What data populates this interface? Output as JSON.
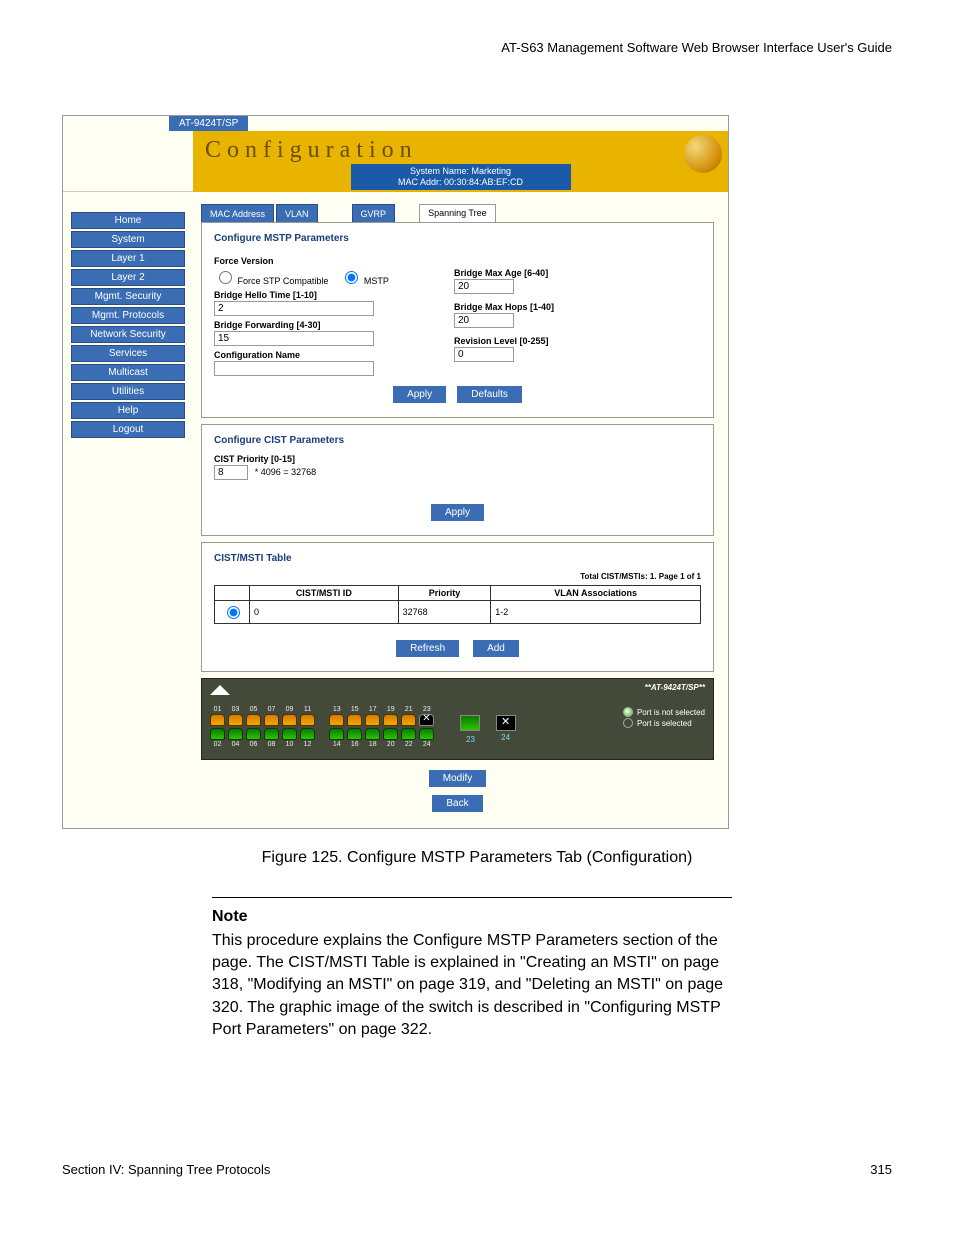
{
  "doc_header": "AT-S63 Management Software Web Browser Interface User's Guide",
  "screenshot": {
    "model_tab": "AT-9424T/SP",
    "title": "Configuration",
    "sysinfo": {
      "line1": "System Name: Marketing",
      "line2": "MAC Addr: 00:30:84:AB:EF:CD"
    },
    "sidebar": [
      "Home",
      "System",
      "Layer 1",
      "Layer 2",
      "Mgmt. Security",
      "Mgmt. Protocols",
      "Network Security",
      "Services",
      "Multicast",
      "Utilities",
      "Help",
      "Logout"
    ],
    "tabs": [
      {
        "label": "MAC Address",
        "active": false
      },
      {
        "label": "VLAN",
        "active": false
      },
      {
        "label": "GVRP",
        "active": false
      },
      {
        "label": "Spanning Tree",
        "active": true
      }
    ],
    "mstp": {
      "section_title": "Configure MSTP Parameters",
      "force_version_label": "Force Version",
      "force_stp_label": "Force STP Compatible",
      "mstp_label": "MSTP",
      "hello_label": "Bridge Hello Time [1-10]",
      "hello_value": "2",
      "fwd_label": "Bridge Forwarding [4-30]",
      "fwd_value": "15",
      "confname_label": "Configuration Name",
      "confname_value": "",
      "maxage_label": "Bridge Max Age [6-40]",
      "maxage_value": "20",
      "maxhops_label": "Bridge Max Hops [1-40]",
      "maxhops_value": "20",
      "rev_label": "Revision Level [0-255]",
      "rev_value": "0",
      "apply": "Apply",
      "defaults": "Defaults"
    },
    "cist": {
      "section_title": "Configure CIST Parameters",
      "priority_label": "CIST Priority [0-15]",
      "priority_value": "8",
      "mult_text": "* 4096 = 32768",
      "apply": "Apply"
    },
    "table": {
      "title": "CIST/MSTI Table",
      "info": "Total CIST/MSTIs: 1. Page 1 of 1",
      "headers": {
        "c1": "CIST/MSTI ID",
        "c2": "Priority",
        "c3": "VLAN Associations"
      },
      "row": {
        "id": "0",
        "priority": "32768",
        "vlan": "1-2"
      },
      "refresh": "Refresh",
      "add": "Add"
    },
    "ports": {
      "model": "**AT-9424T/SP**",
      "top_nums": [
        "01",
        "03",
        "05",
        "07",
        "09",
        "11",
        "13",
        "15",
        "17",
        "19",
        "21",
        "23"
      ],
      "bot_nums": [
        "02",
        "04",
        "06",
        "08",
        "10",
        "12",
        "14",
        "16",
        "18",
        "20",
        "22",
        "24"
      ],
      "extra1": "23",
      "extra2": "24",
      "legend1": "Port is not selected",
      "legend2": "Port is selected",
      "modify": "Modify",
      "back": "Back"
    }
  },
  "figure_caption": "Figure 125. Configure MSTP Parameters Tab (Configuration)",
  "note": {
    "title": "Note",
    "body": "This procedure explains the Configure MSTP Parameters section of the page. The CIST/MSTI Table is explained in \"Creating an MSTI\" on page 318, \"Modifying an MSTI\" on page 319, and \"Deleting an MSTI\" on page 320. The graphic image of the switch is described in \"Configuring MSTP Port Parameters\" on page 322."
  },
  "footer": {
    "left": "Section IV: Spanning Tree Protocols",
    "right": "315"
  }
}
